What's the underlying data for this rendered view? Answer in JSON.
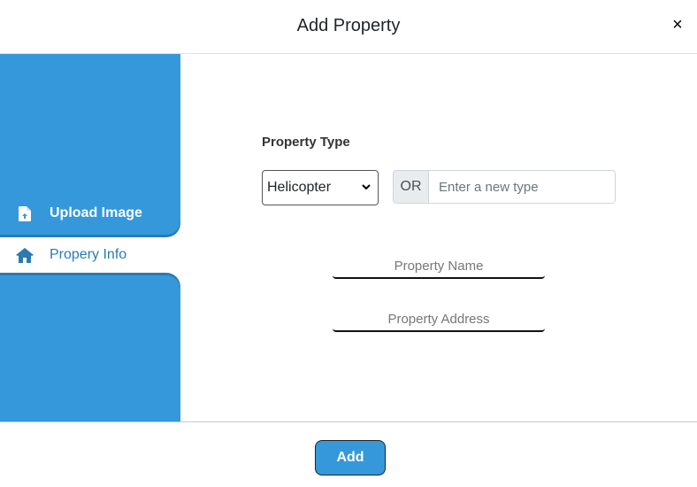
{
  "header": {
    "title": "Add Property",
    "close_icon": "×"
  },
  "sidebar": {
    "items": [
      {
        "label": "Upload Image",
        "icon": "file-upload-icon",
        "active": false
      },
      {
        "label": "Propery Info",
        "icon": "home-icon",
        "active": true
      }
    ]
  },
  "form": {
    "property_type_label": "Property Type",
    "property_type_selected": "Helicopter",
    "or_label": "OR",
    "new_type_placeholder": "Enter a new type",
    "new_type_value": "",
    "property_name_placeholder": "Property Name",
    "property_name_value": "",
    "property_address_placeholder": "Property Address",
    "property_address_value": ""
  },
  "footer": {
    "add_label": "Add"
  },
  "colors": {
    "accent": "#3498db",
    "accent_dark": "#2a7bb3"
  }
}
